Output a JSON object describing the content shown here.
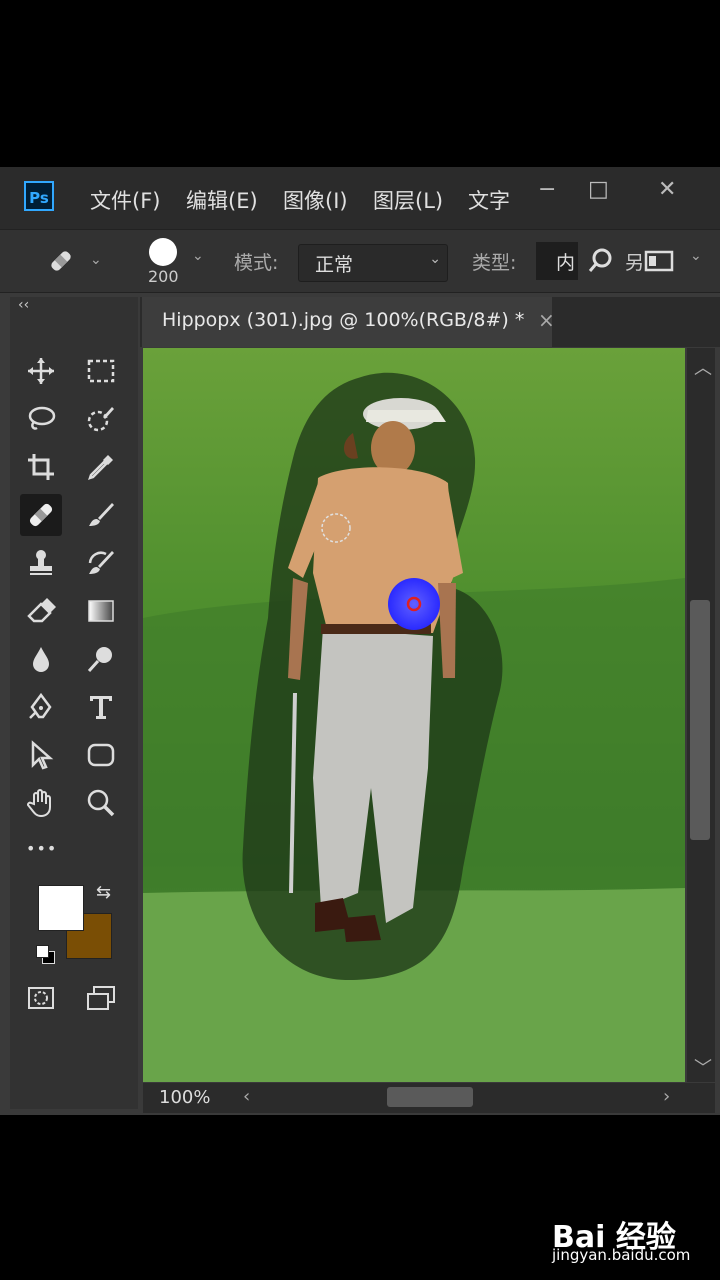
{
  "app": {
    "logo": "Ps"
  },
  "menu": [
    "文件(F)",
    "编辑(E)",
    "图像(I)",
    "图层(L)",
    "文字"
  ],
  "window_controls": {
    "minimize": "−",
    "maximize": "□",
    "close": "✕"
  },
  "options_bar": {
    "brush_size": "200",
    "mode_label": "模式:",
    "mode_value": "正常",
    "type_label": "类型:",
    "type_value": "内",
    "extra_glyph": "另"
  },
  "toolbox": {
    "collapse": "‹‹",
    "more": "•••"
  },
  "document": {
    "tab_title": "Hippopx (301).jpg @ 100%(RGB/8#) *",
    "close": "×",
    "zoom": "100%"
  },
  "colors": {
    "foreground": "#ffffff",
    "background": "#7a4e05",
    "ps_blue": "#31a8ff"
  },
  "watermark": {
    "logo_text": "Bai 经验",
    "url": "jingyan.baidu.com"
  }
}
